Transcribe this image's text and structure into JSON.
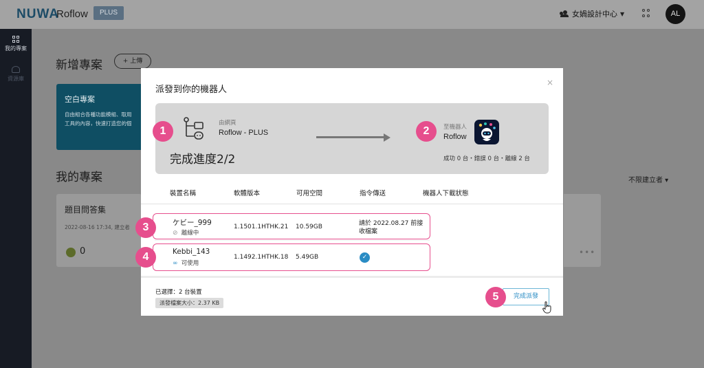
{
  "topbar": {
    "logo": "NUWA",
    "app_name": "Roflow",
    "plan_badge": "PLUS",
    "org_name": "女媧設計中心",
    "avatar_initials": "AL"
  },
  "sidebar": {
    "items": [
      {
        "label": "我的專案",
        "icon": "grid-icon"
      },
      {
        "label": "資源庫",
        "icon": "resource-icon"
      }
    ]
  },
  "main": {
    "new_project_heading": "新增專案",
    "upload_label": "+ 上傳",
    "blank_card": {
      "title": "空白專案",
      "desc_line1": "自由組合各種功能模組、取用",
      "desc_line2": "工具的內容，快速打造您的個"
    },
    "my_projects_heading": "我的專案",
    "filter_label": "不限建立者 ▾",
    "project_card": {
      "title": "題目問答集",
      "meta": "2022-08-16 17:34, 建立者",
      "count": "0"
    }
  },
  "modal": {
    "title": "派發到你的機器人",
    "close": "×",
    "source_caption": "由網頁",
    "source_name": "Roflow - PLUS",
    "progress": "完成進度2/2",
    "dest_caption": "至機器人",
    "dest_name": "Roflow",
    "stats": "成功 0 台・錯誤 0 台・離線 2 台",
    "columns": [
      "裝置名稱",
      "軟體版本",
      "可用空間",
      "指令傳送",
      "機器人下載狀態"
    ],
    "rows": [
      {
        "name": "ケビー_999",
        "state": "離線中",
        "version": "1.1501.1HTHK.21",
        "space": "10.59GB",
        "send_line1": "請於 2022.08.27 前接",
        "send_line2": "收檔案"
      },
      {
        "name": "Kebbi_143",
        "state": "可使用",
        "version": "1.1492.1HTHK.18",
        "space": "5.49GB",
        "send_line1": "",
        "send_line2": ""
      }
    ],
    "selected": "已選擇：2 台裝置",
    "file_size": "派發檔案大小：2.37 KB",
    "done_button": "完成派發"
  },
  "badges": [
    "1",
    "2",
    "3",
    "4",
    "5"
  ],
  "colors": {
    "accent_pink": "#e64e8d",
    "link_blue": "#2a8cc4",
    "sidebar_bg": "#171b24"
  }
}
